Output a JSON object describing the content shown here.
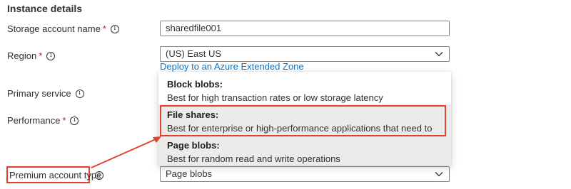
{
  "section": {
    "title": "Instance details"
  },
  "fields": {
    "storage_account_name": {
      "label": "Storage account name",
      "required": "*",
      "value": "sharedfile001"
    },
    "region": {
      "label": "Region",
      "required": "*",
      "value": "(US) East US",
      "link": "Deploy to an Azure Extended Zone"
    },
    "primary_service": {
      "label": "Primary service"
    },
    "performance": {
      "label": "Performance",
      "required": "*"
    },
    "premium_account_type": {
      "label": "Premium account type",
      "value": "Page blobs"
    }
  },
  "info_glyph": "i",
  "dropdown": {
    "options": [
      {
        "title": "Block blobs:",
        "desc": "Best for high transaction rates or low storage latency"
      },
      {
        "title": "File shares:",
        "desc": "Best for enterprise or high-performance applications that need to scale"
      },
      {
        "title": "Page blobs:",
        "desc": "Best for random read and write operations"
      }
    ],
    "selected": "Page blobs:",
    "highlighted": "File shares:"
  },
  "colors": {
    "accent": "#0078d4",
    "annotation": "#e0422f",
    "required": "#a4262c"
  }
}
